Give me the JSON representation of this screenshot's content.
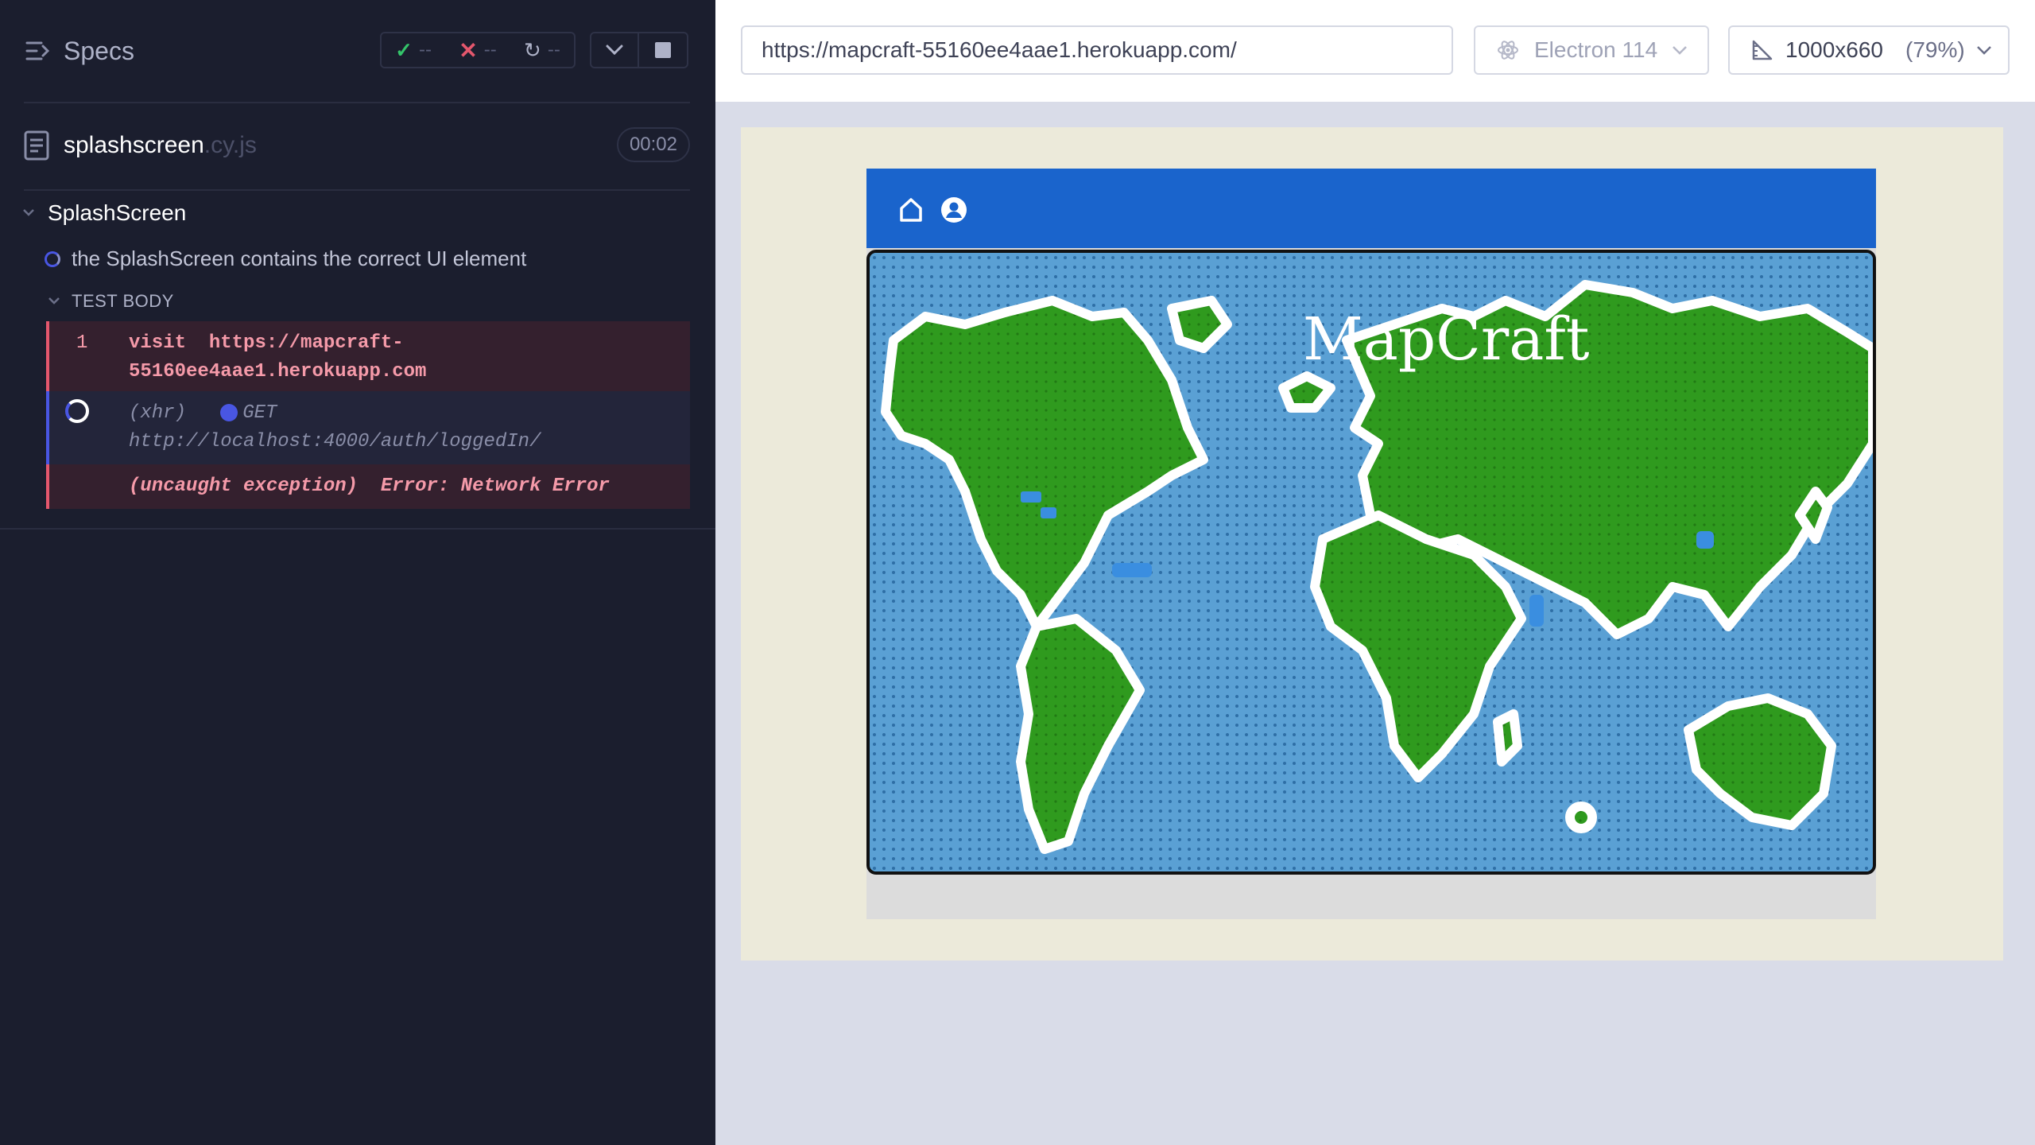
{
  "reporter": {
    "specs_label": "Specs",
    "stats": {
      "passed": "--",
      "failed": "--",
      "pending": "--"
    },
    "spec_file": {
      "name": "splashscreen",
      "ext": ".cy.js",
      "duration": "00:02"
    },
    "suite": "SplashScreen",
    "test": "the SplashScreen contains the correct UI element",
    "test_body_label": "TEST BODY",
    "commands": [
      {
        "num": "1",
        "name": "visit",
        "message": "https://mapcraft-55160ee4aae1.herokuapp.com"
      },
      {
        "name": "(xhr)",
        "method": "GET",
        "url": "http://localhost:4000/auth/loggedIn/"
      },
      {
        "name": "(uncaught exception)",
        "message": "Error: Network Error"
      }
    ]
  },
  "topbar": {
    "url": "https://mapcraft-55160ee4aae1.herokuapp.com/",
    "browser": "Electron 114",
    "viewport": "1000x660",
    "scale": "(79%)"
  },
  "app": {
    "title": "MapCraft",
    "nav_icons": [
      "home-icon",
      "user-account-icon"
    ]
  },
  "colors": {
    "reporter_bg": "#1b1e2e",
    "nav_blue": "#1a64cc",
    "ocean": "#5aa0d4",
    "land": "#2f9a1e",
    "pass": "#34c46a",
    "fail": "#e4576d",
    "spinner": "#4956e3"
  }
}
